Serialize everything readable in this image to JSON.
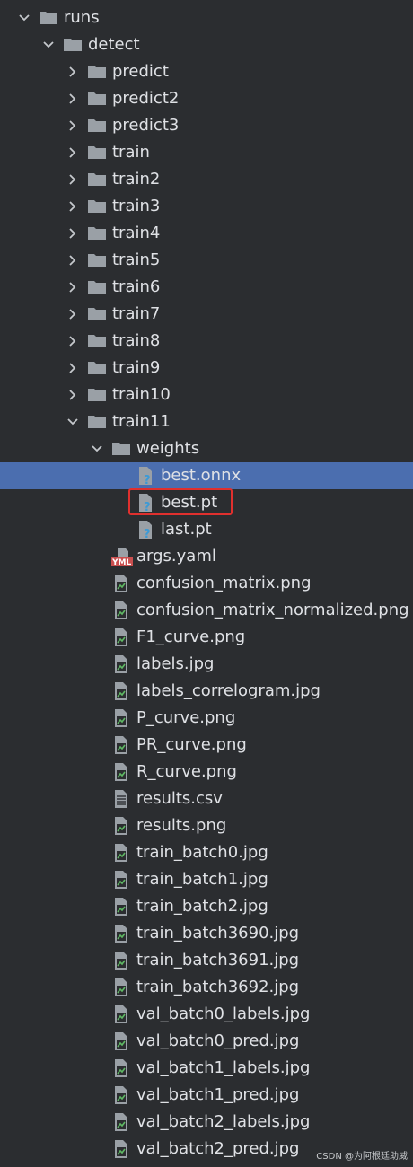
{
  "tree": {
    "rows": [
      {
        "label": "runs",
        "kind": "folder",
        "expanded": true,
        "level": 0
      },
      {
        "label": "detect",
        "kind": "folder",
        "expanded": true,
        "level": 1
      },
      {
        "label": "predict",
        "kind": "folder",
        "expanded": false,
        "level": 2
      },
      {
        "label": "predict2",
        "kind": "folder",
        "expanded": false,
        "level": 2
      },
      {
        "label": "predict3",
        "kind": "folder",
        "expanded": false,
        "level": 2
      },
      {
        "label": "train",
        "kind": "folder",
        "expanded": false,
        "level": 2
      },
      {
        "label": "train2",
        "kind": "folder",
        "expanded": false,
        "level": 2
      },
      {
        "label": "train3",
        "kind": "folder",
        "expanded": false,
        "level": 2
      },
      {
        "label": "train4",
        "kind": "folder",
        "expanded": false,
        "level": 2
      },
      {
        "label": "train5",
        "kind": "folder",
        "expanded": false,
        "level": 2
      },
      {
        "label": "train6",
        "kind": "folder",
        "expanded": false,
        "level": 2
      },
      {
        "label": "train7",
        "kind": "folder",
        "expanded": false,
        "level": 2
      },
      {
        "label": "train8",
        "kind": "folder",
        "expanded": false,
        "level": 2
      },
      {
        "label": "train9",
        "kind": "folder",
        "expanded": false,
        "level": 2
      },
      {
        "label": "train10",
        "kind": "folder",
        "expanded": false,
        "level": 2
      },
      {
        "label": "train11",
        "kind": "folder",
        "expanded": true,
        "level": 2
      },
      {
        "label": "weights",
        "kind": "folder",
        "expanded": true,
        "level": 3
      },
      {
        "label": "best.onnx",
        "kind": "unknown",
        "level": 4,
        "selected": true
      },
      {
        "label": "best.pt",
        "kind": "unknown",
        "level": 4,
        "boxed": true
      },
      {
        "label": "last.pt",
        "kind": "unknown",
        "level": 4
      },
      {
        "label": "args.yaml",
        "kind": "yaml",
        "level": 3
      },
      {
        "label": "confusion_matrix.png",
        "kind": "image",
        "level": 3
      },
      {
        "label": "confusion_matrix_normalized.png",
        "kind": "image",
        "level": 3
      },
      {
        "label": "F1_curve.png",
        "kind": "image",
        "level": 3
      },
      {
        "label": "labels.jpg",
        "kind": "image",
        "level": 3
      },
      {
        "label": "labels_correlogram.jpg",
        "kind": "image",
        "level": 3
      },
      {
        "label": "P_curve.png",
        "kind": "image",
        "level": 3
      },
      {
        "label": "PR_curve.png",
        "kind": "image",
        "level": 3
      },
      {
        "label": "R_curve.png",
        "kind": "image",
        "level": 3
      },
      {
        "label": "results.csv",
        "kind": "text",
        "level": 3
      },
      {
        "label": "results.png",
        "kind": "image",
        "level": 3
      },
      {
        "label": "train_batch0.jpg",
        "kind": "image",
        "level": 3
      },
      {
        "label": "train_batch1.jpg",
        "kind": "image",
        "level": 3
      },
      {
        "label": "train_batch2.jpg",
        "kind": "image",
        "level": 3
      },
      {
        "label": "train_batch3690.jpg",
        "kind": "image",
        "level": 3
      },
      {
        "label": "train_batch3691.jpg",
        "kind": "image",
        "level": 3
      },
      {
        "label": "train_batch3692.jpg",
        "kind": "image",
        "level": 3
      },
      {
        "label": "val_batch0_labels.jpg",
        "kind": "image",
        "level": 3
      },
      {
        "label": "val_batch0_pred.jpg",
        "kind": "image",
        "level": 3
      },
      {
        "label": "val_batch1_labels.jpg",
        "kind": "image",
        "level": 3
      },
      {
        "label": "val_batch1_pred.jpg",
        "kind": "image",
        "level": 3
      },
      {
        "label": "val_batch2_labels.jpg",
        "kind": "image",
        "level": 3
      },
      {
        "label": "val_batch2_pred.jpg",
        "kind": "image",
        "level": 3
      }
    ]
  },
  "yaml_badge": "YML",
  "watermark": "CSDN @为阿根廷助威",
  "colors": {
    "background": "#2b2d30",
    "selection": "#4b6eaf",
    "folder": "#9aa0a6",
    "highlight": "#e0302e",
    "yaml": "#c94f4f",
    "unknown_q": "#3c9ad6"
  }
}
